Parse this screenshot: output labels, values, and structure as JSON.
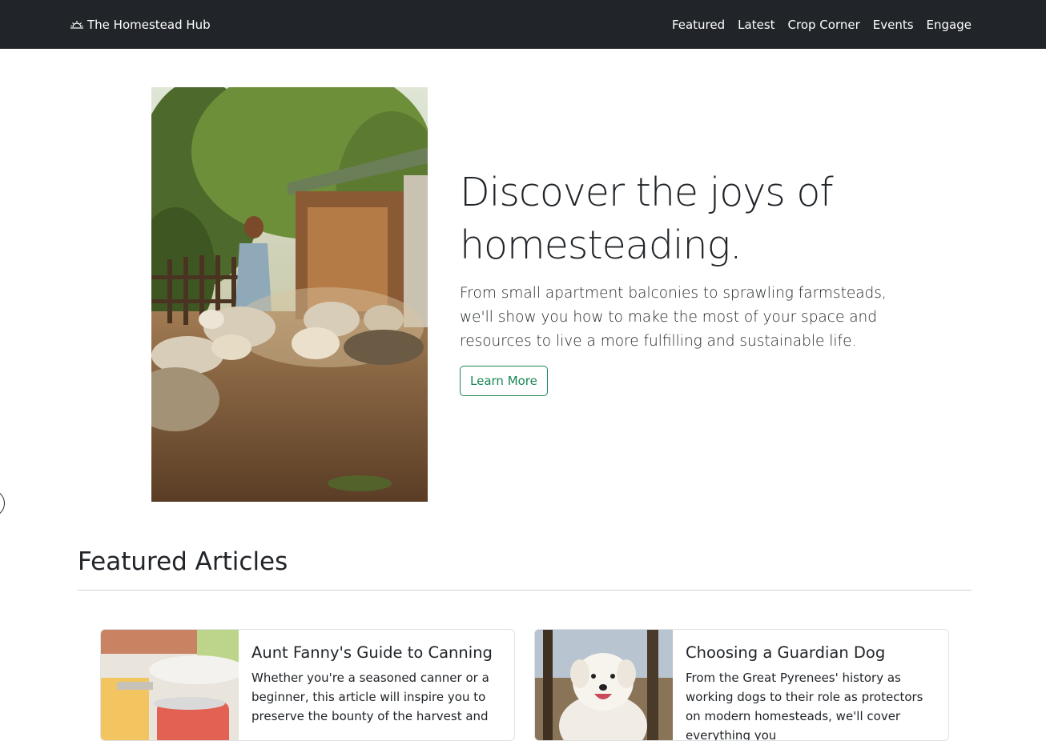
{
  "navbar": {
    "brand": "The Homestead Hub",
    "brand_icon": "sunrise-icon",
    "links": [
      "Featured",
      "Latest",
      "Crop Corner",
      "Events",
      "Engage"
    ]
  },
  "hero": {
    "title": "Discover the joys of homesteading.",
    "lead": "From small apartment balconies to sprawling farmsteads, we'll show you how to make the most of your space and resources to live a more fulfilling and sustainable life.",
    "button_label": "Learn More"
  },
  "featured": {
    "heading": "Featured Articles",
    "cards": [
      {
        "title": "Aunt Fanny's Guide to Canning",
        "text": "Whether you're a seasoned canner or a beginner, this article will inspire you to preserve the bounty of the harvest and"
      },
      {
        "title": "Choosing a Guardian Dog",
        "text": "From the Great Pyrenees' history as working dogs to their role as protectors on modern homesteads, we'll cover everything you"
      }
    ]
  },
  "colors": {
    "navbar_bg": "#212529",
    "accent_green": "#198754",
    "text": "#212529"
  }
}
